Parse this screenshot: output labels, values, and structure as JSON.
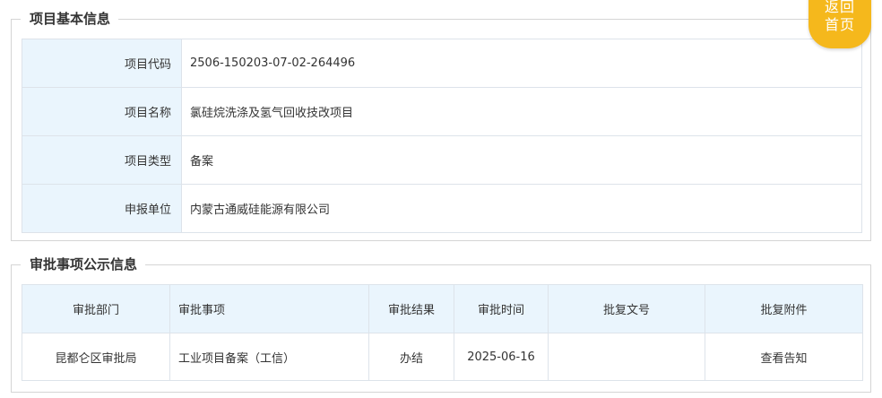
{
  "basic_info": {
    "title": "项目基本信息",
    "rows": [
      {
        "label": "项目代码",
        "value": "2506-150203-07-02-264496"
      },
      {
        "label": "项目名称",
        "value": "氯硅烷洗涤及氢气回收技改项目"
      },
      {
        "label": "项目类型",
        "value": "备案"
      },
      {
        "label": "申报单位",
        "value": "内蒙古通威硅能源有限公司"
      }
    ]
  },
  "approval_info": {
    "title": "审批事项公示信息",
    "headers": [
      "审批部门",
      "审批事项",
      "审批结果",
      "审批时间",
      "批复文号",
      "批复附件"
    ],
    "rows": [
      {
        "department": "昆都仑区审批局",
        "item": "工业项目备案（工信）",
        "result": "办结",
        "date": "2025-06-16",
        "doc_no": "",
        "attachment": "查看告知"
      }
    ]
  },
  "home_button": {
    "line1": "返回",
    "line2": "首页"
  }
}
